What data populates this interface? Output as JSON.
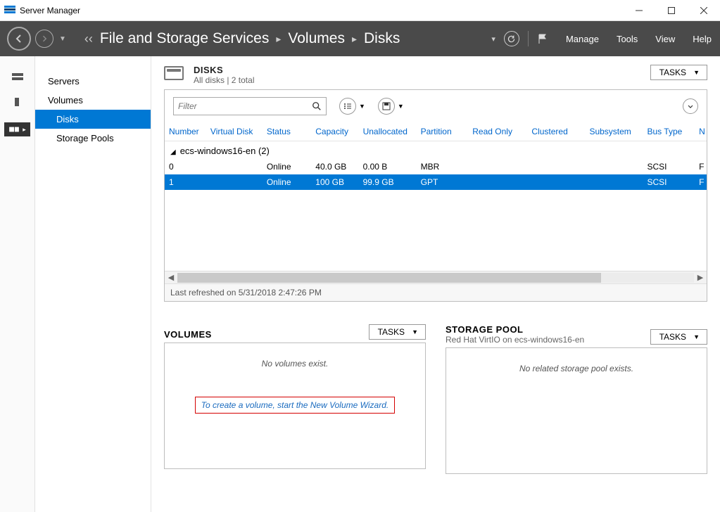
{
  "titlebar": {
    "app_name": "Server Manager"
  },
  "navbar": {
    "breadcrumb": [
      "File and Storage Services",
      "Volumes",
      "Disks"
    ],
    "menu": {
      "manage": "Manage",
      "tools": "Tools",
      "view": "View",
      "help": "Help"
    }
  },
  "sidebar": {
    "items": [
      {
        "label": "Servers"
      },
      {
        "label": "Volumes"
      },
      {
        "label": "Disks"
      },
      {
        "label": "Storage Pools"
      }
    ]
  },
  "disks": {
    "title": "DISKS",
    "subtitle": "All disks | 2 total",
    "tasks_label": "TASKS",
    "filter_placeholder": "Filter",
    "columns": [
      "Number",
      "Virtual Disk",
      "Status",
      "Capacity",
      "Unallocated",
      "Partition",
      "Read Only",
      "Clustered",
      "Subsystem",
      "Bus Type",
      "N"
    ],
    "group_label": "ecs-windows16-en (2)",
    "rows": [
      {
        "number": "0",
        "virtual_disk": "",
        "status": "Online",
        "capacity": "40.0 GB",
        "unallocated": "0.00 B",
        "partition": "MBR",
        "read_only": "",
        "clustered": "",
        "subsystem": "",
        "bus_type": "SCSI",
        "n": "F"
      },
      {
        "number": "1",
        "virtual_disk": "",
        "status": "Online",
        "capacity": "100 GB",
        "unallocated": "99.9 GB",
        "partition": "GPT",
        "read_only": "",
        "clustered": "",
        "subsystem": "",
        "bus_type": "SCSI",
        "n": "F"
      }
    ],
    "last_refreshed": "Last refreshed on 5/31/2018 2:47:26 PM"
  },
  "volumes": {
    "title": "VOLUMES",
    "tasks_label": "TASKS",
    "empty": "No volumes exist.",
    "wizard_text": "To create a volume, start the New Volume Wizard."
  },
  "storage_pool": {
    "title": "STORAGE POOL",
    "subtitle": "Red Hat VirtIO on ecs-windows16-en",
    "tasks_label": "TASKS",
    "empty": "No related storage pool exists."
  }
}
